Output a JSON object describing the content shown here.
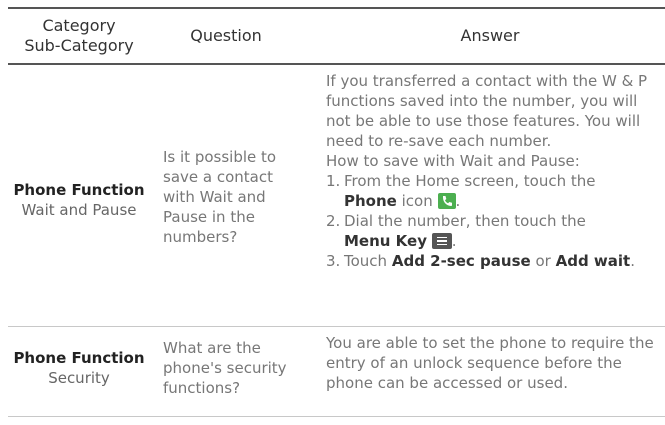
{
  "table": {
    "headers": {
      "category": "Category",
      "subcategory": "Sub-Category",
      "question": "Question",
      "answer": "Answer"
    },
    "rows": [
      {
        "category": "Phone Function",
        "subcategory": "Wait and Pause",
        "question": "Is it possible to save a contact with Wait and Pause in the numbers?",
        "answer_intro": "If you transferred a contact with the W & P functions saved into the number, you will not be able to use those features. You will need to re-save each number.",
        "answer_howto": "How to save with Wait and Pause:",
        "steps": [
          {
            "num": "1.",
            "pre": "From the Home screen, touch the",
            "bold": "Phone",
            "post": "icon",
            "icon": "phone-icon"
          },
          {
            "num": "2.",
            "pre": "Dial the number, then touch the",
            "bold": "Menu Key",
            "icon": "menu-key-icon"
          },
          {
            "num": "3.",
            "pre": "Touch",
            "bold1": "Add 2-sec pause",
            "mid": "or",
            "bold2": "Add wait",
            "end": "."
          }
        ]
      },
      {
        "category": "Phone Function",
        "subcategory": "Security",
        "question": "What are the phone's security functions?",
        "answer": "You are able to set the phone to require the entry of an unlock sequence before the phone can be accessed or used."
      }
    ]
  },
  "colors": {
    "accent_icon": "#4caf50",
    "menu_icon": "#555555",
    "rule": "#555555"
  }
}
